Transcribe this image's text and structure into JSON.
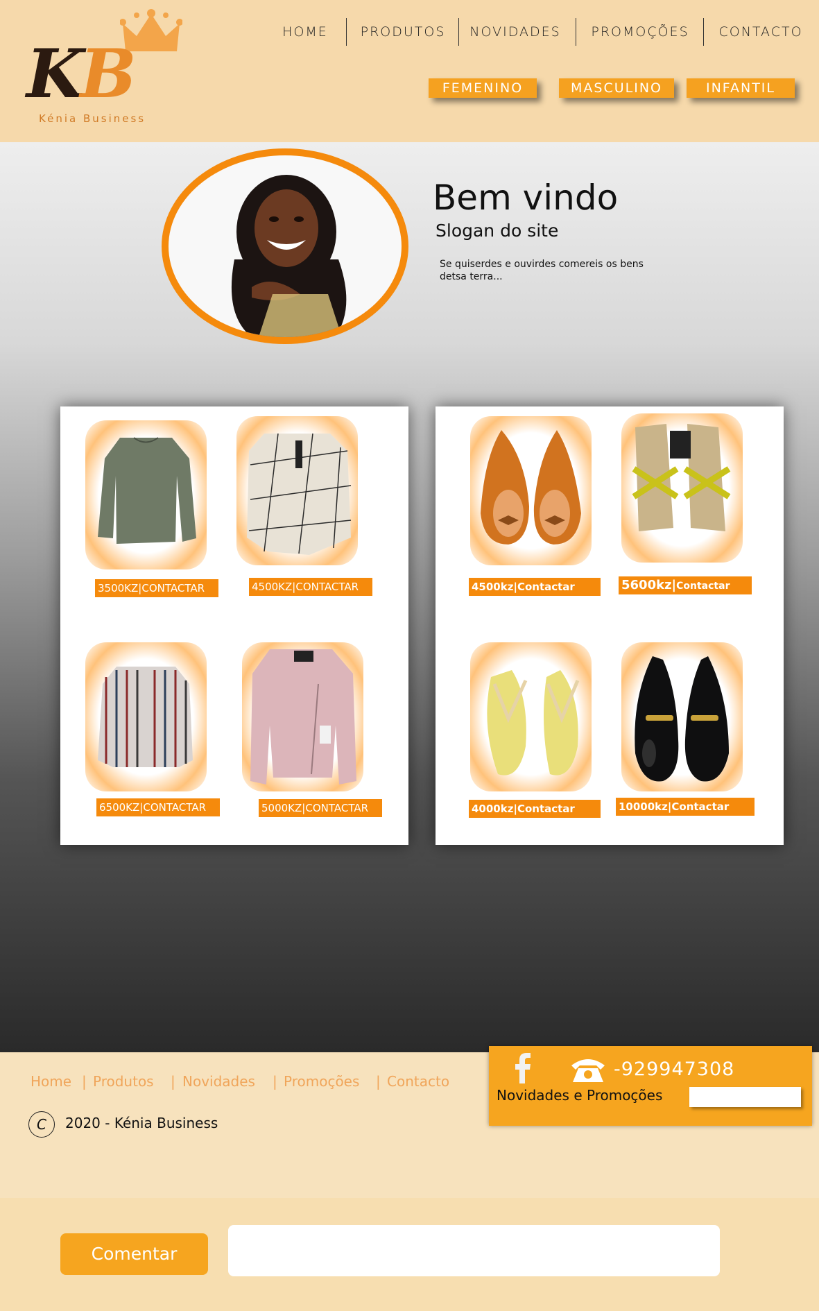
{
  "brand": {
    "logo_text": "KB",
    "logo_subtitle": "Kénia Business"
  },
  "nav": [
    "HOME",
    "PRODUTOS",
    "NOVIDADES",
    "PROMOÇÕES",
    "CONTACTO"
  ],
  "categories": [
    "FEMENINO",
    "MASCULINO",
    "INFANTIL"
  ],
  "hero": {
    "title": "Bem vindo",
    "slogan": "Slogan do site",
    "quote": "Se quiserdes e ouvirdes comereis os bens  detsa terra..."
  },
  "clothes": [
    {
      "price": "3500KZ",
      "action": "CONTACTAR",
      "item": "green-blouse"
    },
    {
      "price": "4500KZ",
      "action": "CONTACTAR",
      "item": "checkered-blouse"
    },
    {
      "price": "6500KZ",
      "action": "CONTACTAR",
      "item": "striped-blouse"
    },
    {
      "price": "5000KZ",
      "action": "CONTACTAR",
      "item": "pink-jacket"
    }
  ],
  "shoes": [
    {
      "price": "4500kz",
      "action": "Contactar",
      "item": "orange-flats"
    },
    {
      "price": "5600kz",
      "action": "Contactar",
      "item": "yellow-sandals"
    },
    {
      "price": "4000kz",
      "action": "Contactar",
      "item": "flip-flops"
    },
    {
      "price": "10000kz",
      "action": "Contactar",
      "item": "black-loafers"
    }
  ],
  "footer": {
    "links": [
      "Home",
      "Produtos",
      "Novidades",
      "Promoções",
      "Contacto"
    ],
    "copyright_symbol": "C",
    "copyright": "2020 - Kénia Business",
    "phone": "-929947308",
    "newsletter_label": "Novidades e Promoções",
    "social_icon": "facebook-icon",
    "phone_icon": "telephone-icon"
  },
  "comment": {
    "button_label": "Comentar",
    "input_value": ""
  },
  "colors": {
    "accent": "#f58a0c",
    "header_bg": "#f6d9ab",
    "box_orange": "#f6a51f"
  }
}
